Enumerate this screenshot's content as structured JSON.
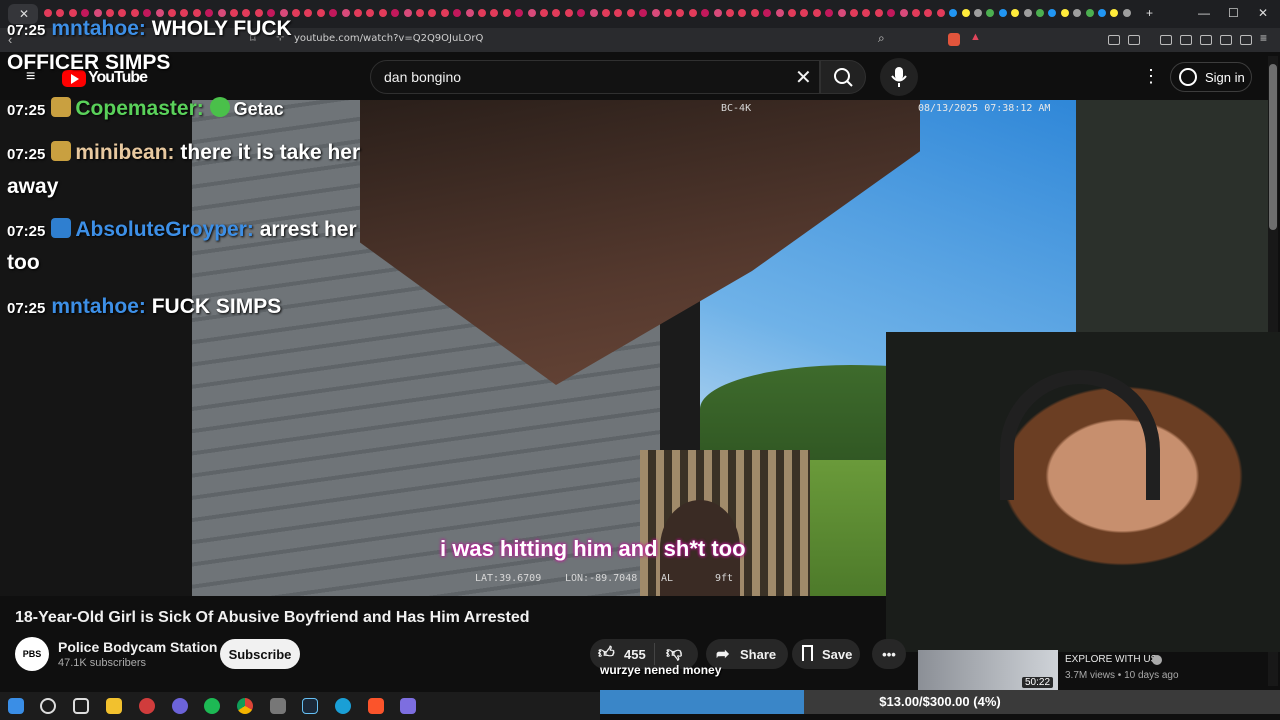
{
  "browser": {
    "url": "youtube.com/watch?v=Q2Q9OJuLOrQ"
  },
  "youtube": {
    "logo_text": "YouTube",
    "search_value": "dan bongino",
    "sign_in": "Sign in"
  },
  "video": {
    "osd_camera": "BC-4K",
    "osd_timestamp": "08/13/2025 07:38:12 AM",
    "osd_lat": "LAT:39.6709",
    "osd_lon": "LON:-89.7048",
    "osd_alt": "AL",
    "osd_alt_value": "9ft",
    "subtitle": "i was hitting him and sh*t too",
    "title": "18-Year-Old Girl is Sick Of Abusive Boyfriend and Has Him Arrested"
  },
  "channel": {
    "avatar_text": "PBS",
    "name": "Police Bodycam Station",
    "subscribers": "47.1K subscribers",
    "subscribe": "Subscribe"
  },
  "actions": {
    "likes": "455",
    "share": "Share",
    "save": "Save"
  },
  "chat": [
    {
      "time": "07:25",
      "user": "mntahoe:",
      "user_color": "#3d8fe6",
      "msg": "WHOLY FUCK"
    },
    {
      "time": "",
      "user": "",
      "user_color": "#ffffff",
      "msg": "OFFICER SIMPS"
    },
    {
      "time": "07:25",
      "user": "Copemaster:",
      "user_color": "#5ad15a",
      "msg": "Getac"
    },
    {
      "time": "07:25",
      "user": "minibean:",
      "user_color": "#e8c9a0",
      "msg": "there it is take her"
    },
    {
      "time": "",
      "user": "",
      "user_color": "#ffffff",
      "msg": "away"
    },
    {
      "time": "07:25",
      "user": "AbsoluteGroyper:",
      "user_color": "#3d8fe6",
      "msg": "arrest her"
    },
    {
      "time": "",
      "user": "",
      "user_color": "#ffffff",
      "msg": "too"
    },
    {
      "time": "07:25",
      "user": "mntahoe:",
      "user_color": "#3d8fe6",
      "msg": "FUCK SIMPS"
    }
  ],
  "recommendation": {
    "title": "EXPLORE WITH US",
    "meta": "3.7M views • 10 days ago",
    "duration": "50:22"
  },
  "donation": {
    "label": "wurzye nened money",
    "progress_text": "$13.00/$300.00 (4%)",
    "progress_fraction": 0.04
  }
}
